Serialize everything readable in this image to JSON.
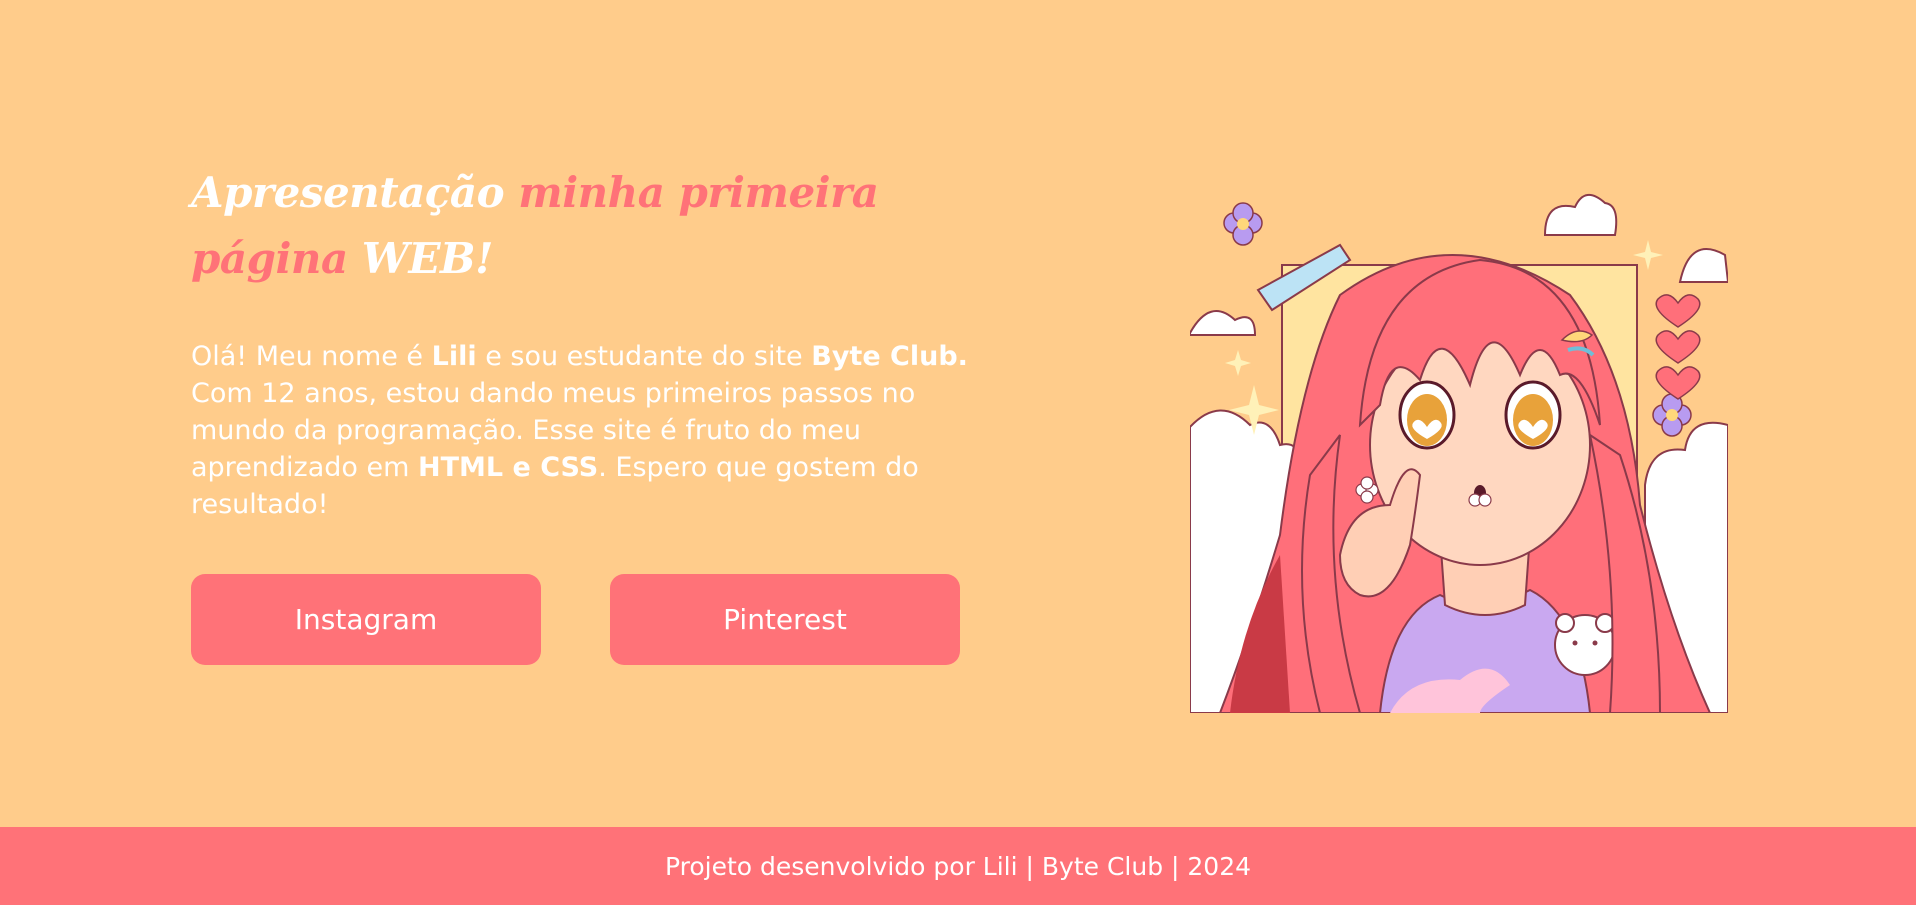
{
  "header": {
    "title_part1": "Apresentação",
    "title_part2": "minha primeira",
    "title_part3": "página",
    "title_part4": "WEB!"
  },
  "intro": {
    "t1": "Olá! Meu nome é ",
    "name": "Lili",
    "t2": " e sou estudante do site ",
    "site": "Byte Club.",
    "t3": " Com 12 anos, estou dando meus primeiros passos no mundo da programação. Esse site é fruto do meu aprendizado em ",
    "tech": "HTML e CSS",
    "t4": ". Espero que gostem do resultado!"
  },
  "links": {
    "instagram_label": "Instagram",
    "pinterest_label": "Pinterest"
  },
  "illustration": {
    "alt": "Ilustração de garota anime com cabelo rosa"
  },
  "footer": {
    "text": "Projeto desenvolvido por Lili | Byte Club | 2024"
  },
  "colors": {
    "background": "#FFCC8B",
    "accent": "#FF7278",
    "text": "#FFFFFF"
  }
}
